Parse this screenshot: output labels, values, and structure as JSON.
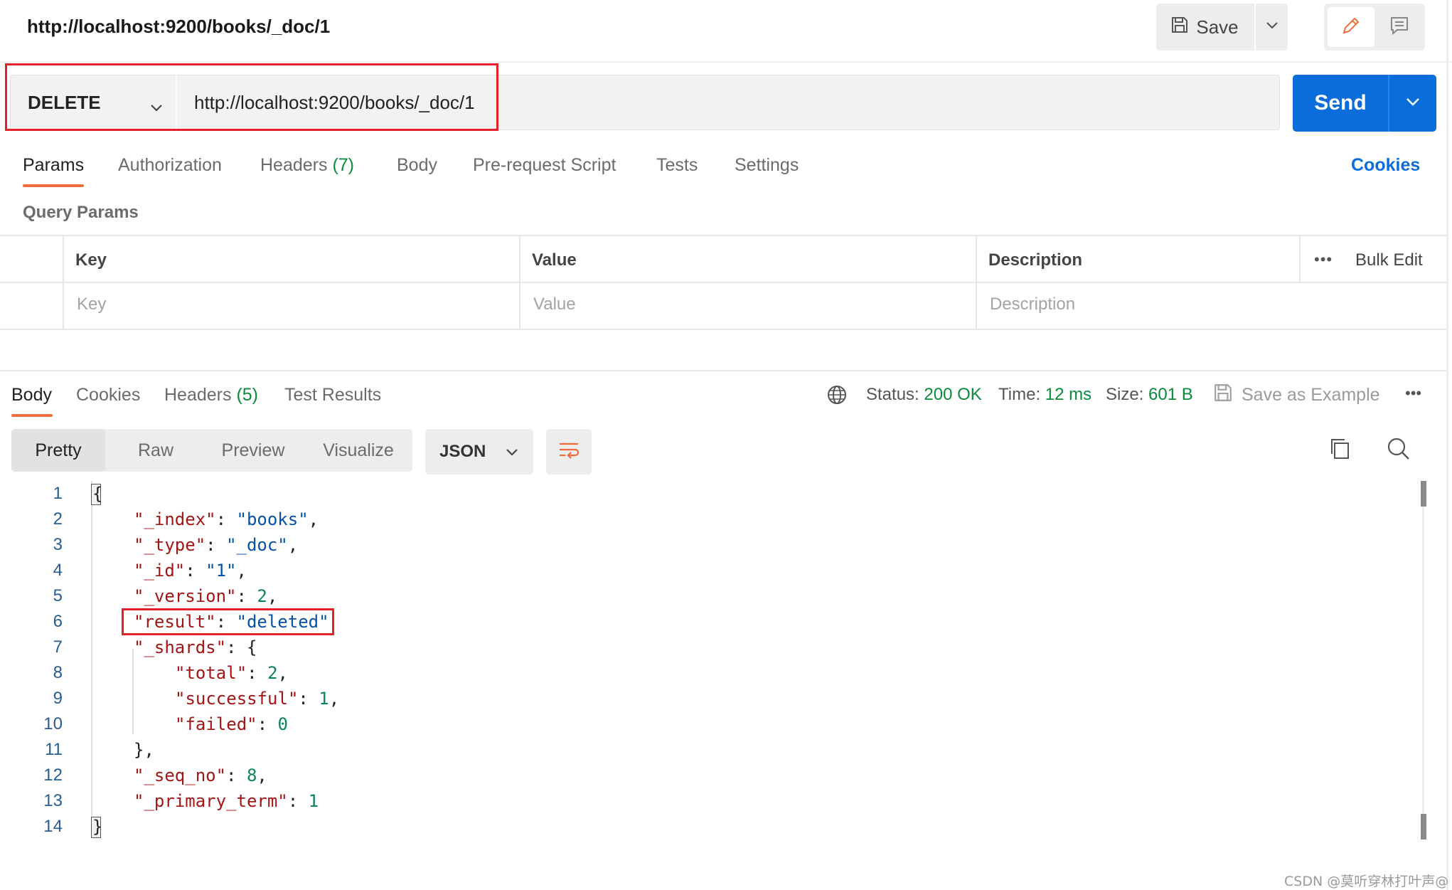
{
  "header": {
    "title": "http://localhost:9200/books/_doc/1",
    "save_label": "Save"
  },
  "request": {
    "method": "DELETE",
    "url": "http://localhost:9200/books/_doc/1",
    "send_label": "Send"
  },
  "request_tabs": {
    "params": "Params",
    "authorization": "Authorization",
    "headers": "Headers",
    "headers_count": "(7)",
    "body": "Body",
    "pre_request": "Pre-request Script",
    "tests": "Tests",
    "settings": "Settings",
    "cookies": "Cookies",
    "active": "Params"
  },
  "query_params": {
    "label": "Query Params",
    "columns": {
      "key": "Key",
      "value": "Value",
      "description": "Description"
    },
    "placeholders": {
      "key": "Key",
      "value": "Value",
      "description": "Description"
    },
    "bulk_edit": "Bulk Edit",
    "more": "•••"
  },
  "response_tabs": {
    "body": "Body",
    "cookies": "Cookies",
    "headers": "Headers",
    "headers_count": "(5)",
    "test_results": "Test Results",
    "active": "Body"
  },
  "response_meta": {
    "status_label": "Status:",
    "status_value": "200 OK",
    "time_label": "Time:",
    "time_value": "12 ms",
    "size_label": "Size:",
    "size_value": "601 B",
    "save_example": "Save as Example",
    "more": "•••"
  },
  "view_modes": {
    "pretty": "Pretty",
    "raw": "Raw",
    "preview": "Preview",
    "visualize": "Visualize",
    "active": "Pretty",
    "format": "JSON"
  },
  "code_lines": {
    "l2_key": "\"_index\"",
    "l2_val": "\"books\"",
    "l3_key": "\"_type\"",
    "l3_val": "\"_doc\"",
    "l4_key": "\"_id\"",
    "l4_val": "\"1\"",
    "l5_key": "\"_version\"",
    "l5_val": "2",
    "l6_key": "\"result\"",
    "l6_val": "\"deleted\"",
    "l7_key": "\"_shards\"",
    "l8_key": "\"total\"",
    "l8_val": "2",
    "l9_key": "\"successful\"",
    "l9_val": "1",
    "l10_key": "\"failed\"",
    "l10_val": "0",
    "l12_key": "\"_seq_no\"",
    "l12_val": "8",
    "l13_key": "\"_primary_term\"",
    "l13_val": "1"
  },
  "line_numbers": [
    "1",
    "2",
    "3",
    "4",
    "5",
    "6",
    "7",
    "8",
    "9",
    "10",
    "11",
    "12",
    "13",
    "14"
  ],
  "colors": {
    "accent": "#0b6cdc",
    "tab_underline": "#f26b3a",
    "status_green": "#0b8a3c",
    "highlight_red": "#e3212b"
  },
  "watermark": "CSDN @莫听穿林打叶声@"
}
